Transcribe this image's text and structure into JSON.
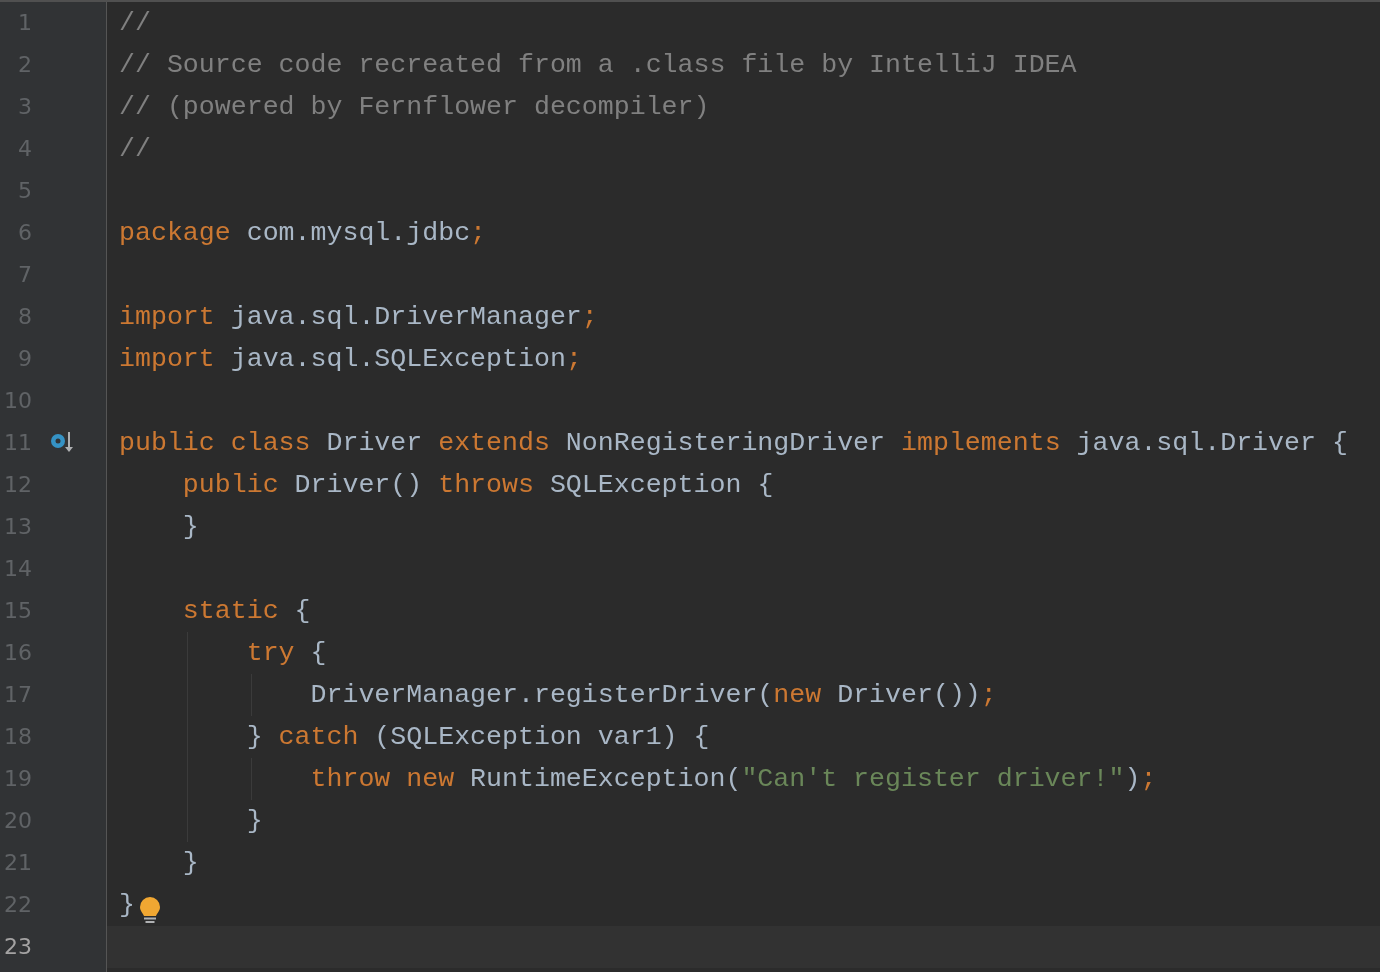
{
  "editor": {
    "lines": [
      {
        "number": "1",
        "current": false,
        "tokens": [
          {
            "kind": "comment",
            "text": "//"
          }
        ]
      },
      {
        "number": "2",
        "current": false,
        "tokens": [
          {
            "kind": "comment",
            "text": "// Source code recreated from a .class file by IntelliJ IDEA"
          }
        ]
      },
      {
        "number": "3",
        "current": false,
        "tokens": [
          {
            "kind": "comment",
            "text": "// (powered by Fernflower decompiler)"
          }
        ]
      },
      {
        "number": "4",
        "current": false,
        "tokens": [
          {
            "kind": "comment",
            "text": "//"
          }
        ]
      },
      {
        "number": "5",
        "current": false
      },
      {
        "number": "6",
        "current": false,
        "tokens": [
          {
            "kind": "keyword",
            "text": "package"
          },
          {
            "kind": "plain",
            "text": " com.mysql.jdbc"
          },
          {
            "kind": "keyword",
            "text": ";"
          }
        ]
      },
      {
        "number": "7",
        "current": false
      },
      {
        "number": "8",
        "current": false,
        "tokens": [
          {
            "kind": "keyword",
            "text": "import"
          },
          {
            "kind": "plain",
            "text": " java.sql.DriverManager"
          },
          {
            "kind": "keyword",
            "text": ";"
          }
        ]
      },
      {
        "number": "9",
        "current": false,
        "tokens": [
          {
            "kind": "keyword",
            "text": "import"
          },
          {
            "kind": "plain",
            "text": " java.sql.SQLException"
          },
          {
            "kind": "keyword",
            "text": ";"
          }
        ]
      },
      {
        "number": "10",
        "current": false
      },
      {
        "number": "11",
        "current": false,
        "implements_marker": true,
        "tokens": [
          {
            "kind": "keyword",
            "text": "public class"
          },
          {
            "kind": "plain",
            "text": " Driver "
          },
          {
            "kind": "keyword",
            "text": "extends"
          },
          {
            "kind": "plain",
            "text": " NonRegisteringDriver "
          },
          {
            "kind": "keyword",
            "text": "implements"
          },
          {
            "kind": "plain",
            "text": " java.sql.Driver {"
          }
        ]
      },
      {
        "number": "12",
        "current": false,
        "tokens": [
          {
            "kind": "keyword",
            "text": "    public"
          },
          {
            "kind": "plain",
            "text": " Driver() "
          },
          {
            "kind": "keyword",
            "text": "throws"
          },
          {
            "kind": "plain",
            "text": " SQLException {"
          }
        ]
      },
      {
        "number": "13",
        "current": false,
        "tokens": [
          {
            "kind": "plain",
            "text": "    }"
          }
        ]
      },
      {
        "number": "14",
        "current": false
      },
      {
        "number": "15",
        "current": false,
        "tokens": [
          {
            "kind": "keyword",
            "text": "    static"
          },
          {
            "kind": "plain",
            "text": " {"
          }
        ]
      },
      {
        "number": "16",
        "current": false,
        "tokens": [
          {
            "kind": "keyword",
            "text": "        try"
          },
          {
            "kind": "plain",
            "text": " {"
          }
        ]
      },
      {
        "number": "17",
        "current": false,
        "tokens": [
          {
            "kind": "plain",
            "text": "            DriverManager.registerDriver("
          },
          {
            "kind": "keyword",
            "text": "new"
          },
          {
            "kind": "plain",
            "text": " Driver())"
          },
          {
            "kind": "keyword",
            "text": ";"
          }
        ]
      },
      {
        "number": "18",
        "current": false,
        "tokens": [
          {
            "kind": "plain",
            "text": "        } "
          },
          {
            "kind": "keyword",
            "text": "catch"
          },
          {
            "kind": "plain",
            "text": " (SQLException var1) {"
          }
        ]
      },
      {
        "number": "19",
        "current": false,
        "tokens": [
          {
            "kind": "keyword",
            "text": "            throw new"
          },
          {
            "kind": "plain",
            "text": " RuntimeException("
          },
          {
            "kind": "string",
            "text": "\"Can't register driver!\""
          },
          {
            "kind": "plain",
            "text": ")"
          },
          {
            "kind": "keyword",
            "text": ";"
          }
        ]
      },
      {
        "number": "20",
        "current": false,
        "tokens": [
          {
            "kind": "plain",
            "text": "        }"
          }
        ]
      },
      {
        "number": "21",
        "current": false,
        "tokens": [
          {
            "kind": "plain",
            "text": "    }"
          }
        ]
      },
      {
        "number": "22",
        "current": false,
        "bulb": true,
        "tokens": [
          {
            "kind": "plain",
            "text": "}"
          }
        ]
      },
      {
        "number": "23",
        "current": true
      }
    ]
  }
}
